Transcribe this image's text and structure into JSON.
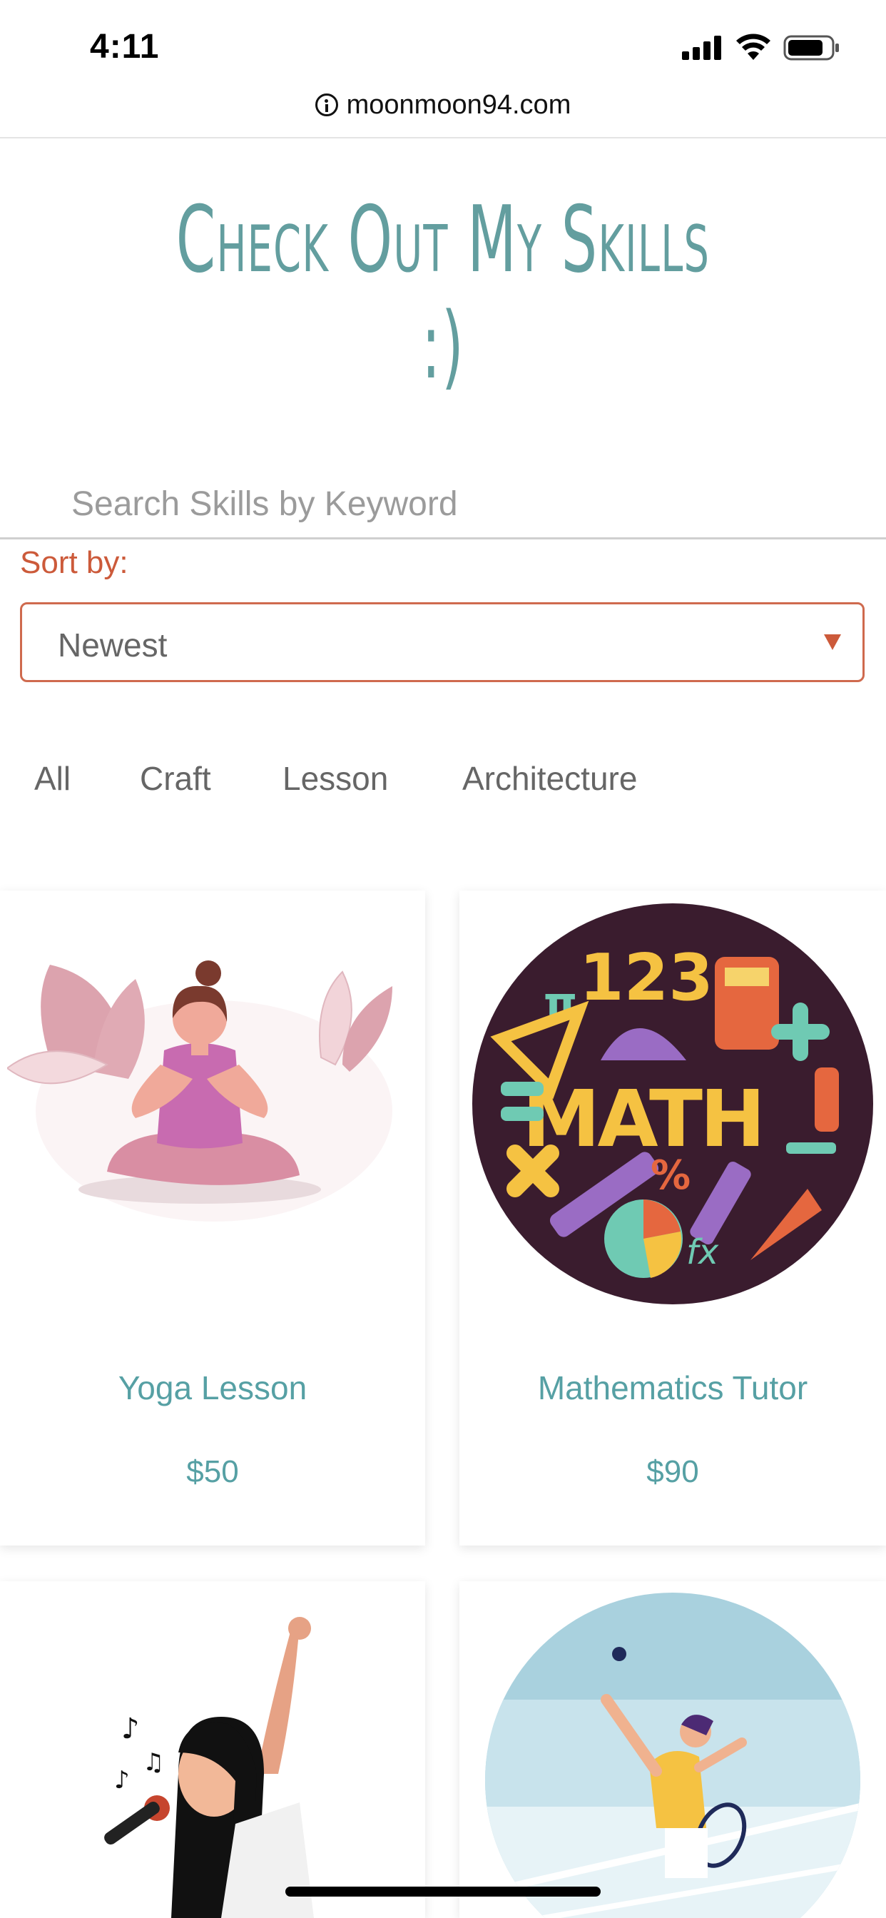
{
  "status_bar": {
    "time": "4:11"
  },
  "browser": {
    "url": "moonmoon94.com"
  },
  "page": {
    "title": "Check Out My Skills :)",
    "search_placeholder": "Search Skills by Keyword",
    "sort_label": "Sort by:",
    "sort_selected": "Newest",
    "filters": [
      "All",
      "Craft",
      "Lesson",
      "Architecture"
    ]
  },
  "cards": [
    {
      "title": "Yoga Lesson",
      "price": "$50",
      "image_icon": "yoga-illustration"
    },
    {
      "title": "Mathematics Tutor",
      "price": "$90",
      "image_icon": "math-illustration"
    },
    {
      "title": "",
      "price": "",
      "image_icon": "singing-illustration"
    },
    {
      "title": "",
      "price": "",
      "image_icon": "tennis-illustration"
    }
  ],
  "math_art": {
    "numbers": "123",
    "word": "MATH",
    "pi": "π",
    "percent": "%",
    "fx": "fx"
  },
  "colors": {
    "accent_teal": "#56a0a4",
    "title_teal": "#639e9f",
    "accent_orange": "#cc5a3a"
  }
}
